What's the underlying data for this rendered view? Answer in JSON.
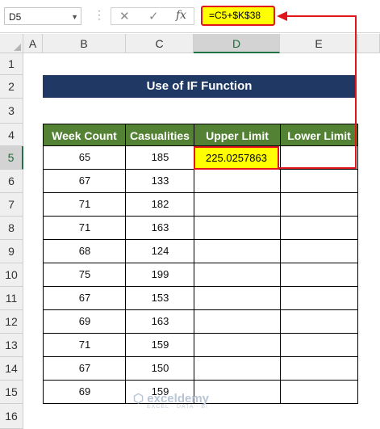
{
  "formula_bar": {
    "name_box": "D5",
    "cancel_icon": "✕",
    "enter_icon": "✓",
    "fx_label": "fx",
    "formula": "=C5+$K$38"
  },
  "sheet": {
    "columns": [
      "A",
      "B",
      "C",
      "D",
      "E"
    ],
    "selected_column": "D",
    "rows": [
      "1",
      "2",
      "3",
      "4",
      "5",
      "6",
      "7",
      "8",
      "9",
      "10",
      "11",
      "12",
      "13",
      "14",
      "15",
      "16"
    ],
    "selected_row": "5",
    "title": "Use of IF Function",
    "headers": [
      "Week Count",
      "Casualities",
      "Upper Limit",
      "Lower Limit"
    ],
    "data": [
      {
        "week": "65",
        "cas": "185"
      },
      {
        "week": "67",
        "cas": "133"
      },
      {
        "week": "71",
        "cas": "182"
      },
      {
        "week": "71",
        "cas": "163"
      },
      {
        "week": "68",
        "cas": "124"
      },
      {
        "week": "75",
        "cas": "199"
      },
      {
        "week": "67",
        "cas": "153"
      },
      {
        "week": "69",
        "cas": "163"
      },
      {
        "week": "71",
        "cas": "159"
      },
      {
        "week": "67",
        "cas": "150"
      },
      {
        "week": "69",
        "cas": "159"
      }
    ],
    "selected_value": "225.0257863"
  },
  "watermark": {
    "name": "exceldemy",
    "tagline": "EXCEL · DATA · BI"
  },
  "colors": {
    "title_bg": "#203864",
    "header_bg": "#548235",
    "highlight": "#ffff00",
    "annotation": "#e0161b"
  }
}
